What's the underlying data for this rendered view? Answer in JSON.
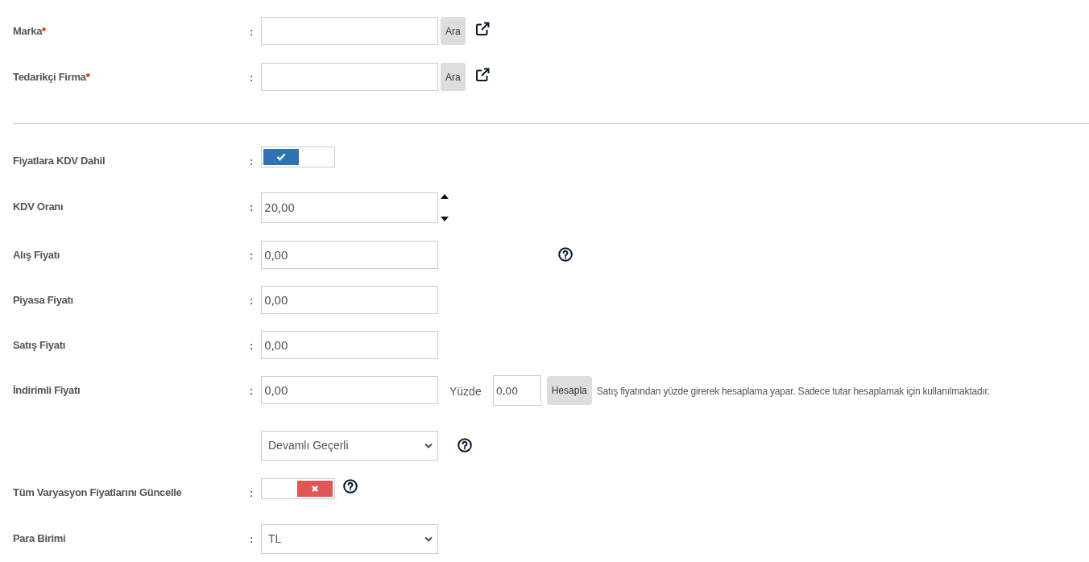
{
  "rows": [
    {
      "kind": "lookup",
      "label": "Marka",
      "required": "*",
      "colon": ":",
      "value": "",
      "button": "Ara"
    },
    {
      "kind": "lookup",
      "label": "Tedarikçi Firma",
      "required": "*",
      "colon": ":",
      "value": "",
      "button": "Ara"
    },
    {
      "kind": "divider"
    },
    {
      "kind": "toggle",
      "label": "Fiyatlara KDV Dahil",
      "colon": ":",
      "on": true,
      "help": false
    },
    {
      "kind": "spinner",
      "label": "KDV Oranı",
      "colon": ":",
      "value": "20,00"
    },
    {
      "kind": "input",
      "label": "Alış Fiyatı",
      "colon": ":",
      "value": "0,00",
      "help": true
    },
    {
      "kind": "input",
      "label": "Piyasa Fiyatı",
      "colon": ":",
      "value": "0,00",
      "help": false
    },
    {
      "kind": "input",
      "label": "Satış Fiyatı",
      "colon": ":",
      "value": "0,00",
      "help": false
    },
    {
      "kind": "discount",
      "label": "İndirimli Fiyatı",
      "colon": ":",
      "value": "0,00",
      "percent_label": "Yüzde",
      "percent_value": "0,00",
      "button": "Hesapla",
      "note": "Satış fiyatından yüzde girerek hesaplama yapar. Sadece tutar hesaplamak için kullanılmaktadır."
    },
    {
      "kind": "select",
      "value": "Devamlı Geçerli",
      "help": true
    },
    {
      "kind": "toggle",
      "label": "Tüm Varyasyon Fiyatlarını Güncelle",
      "colon": ":",
      "on": false,
      "help": true
    },
    {
      "kind": "select",
      "label": "Para Birimi",
      "colon": ":",
      "value": "TL",
      "help": false
    }
  ]
}
